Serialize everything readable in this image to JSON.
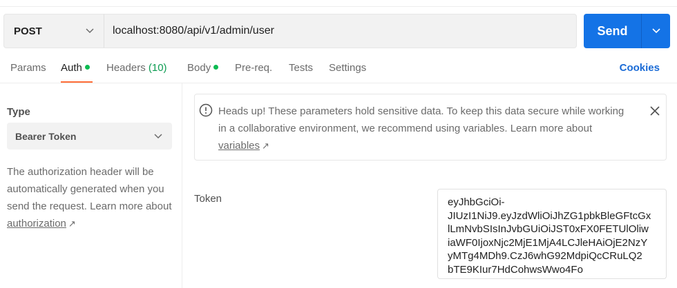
{
  "request": {
    "method": "POST",
    "url": "localhost:8080/api/v1/admin/user",
    "send_label": "Send"
  },
  "tabs": [
    {
      "label": "Params"
    },
    {
      "label": "Auth"
    },
    {
      "label": "Headers",
      "count": "(10)"
    },
    {
      "label": "Body"
    },
    {
      "label": "Pre-req."
    },
    {
      "label": "Tests"
    },
    {
      "label": "Settings"
    }
  ],
  "cookies_label": "Cookies",
  "auth": {
    "type_label": "Type",
    "type_value": "Bearer Token",
    "description": "The authorization header will be automatically generated when you send the request. Learn more about ",
    "description_link": "authorization",
    "link_arrow": "↗"
  },
  "notice": {
    "text": "Heads up! These parameters hold sensitive data. To keep this data secure while working in a collaborative environment, we recommend using variables. Learn more about ",
    "link": "variables",
    "link_arrow": "↗"
  },
  "token": {
    "label": "Token",
    "lines": [
      "eyJhbGciOi-",
      "JIUzI1NiJ9.eyJzdWliOiJhZG1pbkBleGFtcGx",
      "lLmNvbSIsInJvbGUiOiJST0xFX0FETUlOliw",
      "iaWF0IjoxNjc2MjE1MjA4LCJleHAiOjE2NzY",
      "yMTg4MDh9.CzJ6whG92MdpiQcCRuLQ2",
      "bTE9KIur7HdCohwsWwo4Fo"
    ]
  },
  "colors": {
    "send": "#1473e6",
    "active_tab_underline": "#ff6c37",
    "status_dot": "#0cbb52",
    "cookies": "#1a6bd6"
  }
}
